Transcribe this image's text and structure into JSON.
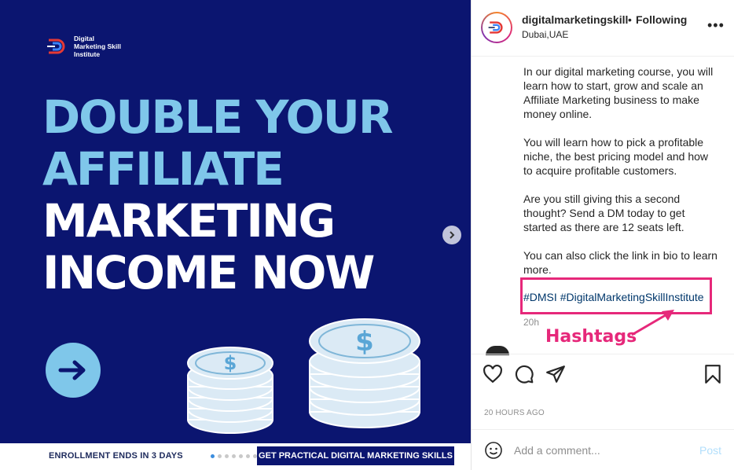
{
  "post_image": {
    "brand_text": "Digital Marketing Skill Institute",
    "headline": [
      "DOUBLE YOUR",
      "AFFILIATE",
      "MARKETING",
      "INCOME NOW"
    ],
    "footer_left": "ENROLLMENT ENDS IN 3 DAYS",
    "footer_cta": "GET PRACTICAL DIGITAL MARKETING SKILLS",
    "carousel_slides": 8,
    "carousel_active_index": 0
  },
  "header": {
    "username": "digitalmarketingskill",
    "separator": "•",
    "follow_status": "Following",
    "location": "Dubai,UAE",
    "more_label": "•••"
  },
  "caption": {
    "paragraphs": [
      "In our digital marketing course, you will learn how to start, grow and scale an Affiliate Marketing business to make money online.",
      "You will learn how to pick a profitable niche, the best pricing model and how to acquire profitable customers.",
      "Are you still giving this a second thought? Send a DM today to get started as there are 12 seats left.",
      "You can also click the link in bio to learn more."
    ],
    "hashtag_1": "#DMSI",
    "hashtag_2": "#DigitalMarketingSkillInstitute",
    "time_ago": "20h"
  },
  "annotation": {
    "label": "Hashtags",
    "color": "#e6287a"
  },
  "actions": {
    "icons": [
      "heart-icon",
      "comment-icon",
      "share-icon",
      "bookmark-icon"
    ],
    "timestamp": "20 HOURS AGO"
  },
  "add_comment": {
    "placeholder": "Add a comment...",
    "post_label": "Post"
  },
  "colors": {
    "image_bg": "#0b1570",
    "accent_light_blue": "#7fc7ea",
    "link": "#00376b",
    "annotation": "#e6287a"
  }
}
